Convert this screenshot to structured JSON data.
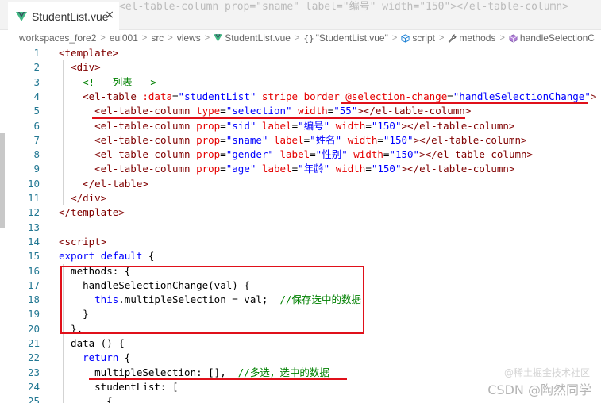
{
  "tab": {
    "title": "StudentList.vue",
    "close": "×"
  },
  "ghost_line": "<el-table-column prop=\"sname\" label=\"编号\" width=\"150\"></el-table-column>",
  "breadcrumb": {
    "items": [
      "workspaces_fore2",
      "eui001",
      "src",
      "views",
      "StudentList.vue",
      "\"StudentList.vue\"",
      "script",
      "methods",
      "handleSelectionC"
    ],
    "separator": ">"
  },
  "colors": {
    "accent_red": "#e0101a",
    "tag": "#800000",
    "attr": "#e50000",
    "string": "#0000ff",
    "comment": "#008000",
    "line_number": "#237893",
    "vue_green": "#41b883"
  },
  "code_lines": [
    {
      "n": "1",
      "tokens": [
        [
          "tag",
          "<template>"
        ]
      ]
    },
    {
      "n": "2",
      "tokens": [
        [
          "txt",
          "  "
        ],
        [
          "tag",
          "<div>"
        ]
      ]
    },
    {
      "n": "3",
      "tokens": [
        [
          "txt",
          "    "
        ],
        [
          "cmt",
          "<!-- 列表 -->"
        ]
      ]
    },
    {
      "n": "4",
      "tokens": [
        [
          "txt",
          "    "
        ],
        [
          "tag",
          "<el-table"
        ],
        [
          "txt",
          " "
        ],
        [
          "attr",
          ":data"
        ],
        [
          "txt",
          "="
        ],
        [
          "str",
          "\"studentList\""
        ],
        [
          "txt",
          " "
        ],
        [
          "attr",
          "stripe"
        ],
        [
          "txt",
          " "
        ],
        [
          "attr",
          "border"
        ],
        [
          "txt",
          " "
        ],
        [
          "attr",
          "@selection-change"
        ],
        [
          "txt",
          "="
        ],
        [
          "str",
          "\"handleSelectionChange\""
        ],
        [
          "tag",
          ">"
        ]
      ]
    },
    {
      "n": "5",
      "tokens": [
        [
          "txt",
          "      "
        ],
        [
          "tag",
          "<el-table-column"
        ],
        [
          "txt",
          " "
        ],
        [
          "attr",
          "type"
        ],
        [
          "txt",
          "="
        ],
        [
          "str",
          "\"selection\""
        ],
        [
          "txt",
          " "
        ],
        [
          "attr",
          "width"
        ],
        [
          "txt",
          "="
        ],
        [
          "str",
          "\"55\""
        ],
        [
          "tag",
          "></el-table-column>"
        ]
      ]
    },
    {
      "n": "6",
      "tokens": [
        [
          "txt",
          "      "
        ],
        [
          "tag",
          "<el-table-column"
        ],
        [
          "txt",
          " "
        ],
        [
          "attr",
          "prop"
        ],
        [
          "txt",
          "="
        ],
        [
          "str",
          "\"sid\""
        ],
        [
          "txt",
          " "
        ],
        [
          "attr",
          "label"
        ],
        [
          "txt",
          "="
        ],
        [
          "str",
          "\"编号\""
        ],
        [
          "txt",
          " "
        ],
        [
          "attr",
          "width"
        ],
        [
          "txt",
          "="
        ],
        [
          "str",
          "\"150\""
        ],
        [
          "tag",
          "></el-table-column>"
        ]
      ]
    },
    {
      "n": "7",
      "tokens": [
        [
          "txt",
          "      "
        ],
        [
          "tag",
          "<el-table-column"
        ],
        [
          "txt",
          " "
        ],
        [
          "attr",
          "prop"
        ],
        [
          "txt",
          "="
        ],
        [
          "str",
          "\"sname\""
        ],
        [
          "txt",
          " "
        ],
        [
          "attr",
          "label"
        ],
        [
          "txt",
          "="
        ],
        [
          "str",
          "\"姓名\""
        ],
        [
          "txt",
          " "
        ],
        [
          "attr",
          "width"
        ],
        [
          "txt",
          "="
        ],
        [
          "str",
          "\"150\""
        ],
        [
          "tag",
          "></el-table-column>"
        ]
      ]
    },
    {
      "n": "8",
      "tokens": [
        [
          "txt",
          "      "
        ],
        [
          "tag",
          "<el-table-column"
        ],
        [
          "txt",
          " "
        ],
        [
          "attr",
          "prop"
        ],
        [
          "txt",
          "="
        ],
        [
          "str",
          "\"gender\""
        ],
        [
          "txt",
          " "
        ],
        [
          "attr",
          "label"
        ],
        [
          "txt",
          "="
        ],
        [
          "str",
          "\"性别\""
        ],
        [
          "txt",
          " "
        ],
        [
          "attr",
          "width"
        ],
        [
          "txt",
          "="
        ],
        [
          "str",
          "\"150\""
        ],
        [
          "tag",
          "></el-table-column>"
        ]
      ]
    },
    {
      "n": "9",
      "tokens": [
        [
          "txt",
          "      "
        ],
        [
          "tag",
          "<el-table-column"
        ],
        [
          "txt",
          " "
        ],
        [
          "attr",
          "prop"
        ],
        [
          "txt",
          "="
        ],
        [
          "str",
          "\"age\""
        ],
        [
          "txt",
          " "
        ],
        [
          "attr",
          "label"
        ],
        [
          "txt",
          "="
        ],
        [
          "str",
          "\"年龄\""
        ],
        [
          "txt",
          " "
        ],
        [
          "attr",
          "width"
        ],
        [
          "txt",
          "="
        ],
        [
          "str",
          "\"150\""
        ],
        [
          "tag",
          "></el-table-column>"
        ]
      ]
    },
    {
      "n": "10",
      "tokens": [
        [
          "txt",
          "    "
        ],
        [
          "tag",
          "</el-table>"
        ]
      ]
    },
    {
      "n": "11",
      "tokens": [
        [
          "txt",
          "  "
        ],
        [
          "tag",
          "</div>"
        ]
      ]
    },
    {
      "n": "12",
      "tokens": [
        [
          "tag",
          "</template>"
        ]
      ]
    },
    {
      "n": "13",
      "tokens": []
    },
    {
      "n": "14",
      "tokens": [
        [
          "tag",
          "<script>"
        ]
      ]
    },
    {
      "n": "15",
      "tokens": [
        [
          "kw",
          "export"
        ],
        [
          "txt",
          " "
        ],
        [
          "kw",
          "default"
        ],
        [
          "txt",
          " {"
        ]
      ]
    },
    {
      "n": "16",
      "tokens": [
        [
          "txt",
          "  methods: {"
        ]
      ]
    },
    {
      "n": "17",
      "tokens": [
        [
          "txt",
          "    handleSelectionChange(val) {"
        ]
      ]
    },
    {
      "n": "18",
      "tokens": [
        [
          "txt",
          "      "
        ],
        [
          "kw",
          "this"
        ],
        [
          "txt",
          ".multipleSelection = val;  "
        ],
        [
          "cmt",
          "//保存选中的数据"
        ]
      ]
    },
    {
      "n": "19",
      "tokens": [
        [
          "txt",
          "    }"
        ]
      ]
    },
    {
      "n": "20",
      "tokens": [
        [
          "txt",
          "  },"
        ]
      ]
    },
    {
      "n": "21",
      "tokens": [
        [
          "txt",
          "  data () {"
        ]
      ]
    },
    {
      "n": "22",
      "tokens": [
        [
          "txt",
          "    "
        ],
        [
          "kw",
          "return"
        ],
        [
          "txt",
          " {"
        ]
      ]
    },
    {
      "n": "23",
      "tokens": [
        [
          "txt",
          "      multipleSelection: [],  "
        ],
        [
          "cmt",
          "//多选，选中的数据"
        ]
      ]
    },
    {
      "n": "24",
      "tokens": [
        [
          "txt",
          "      studentList: ["
        ]
      ]
    },
    {
      "n": "25",
      "tokens": [
        [
          "txt",
          "        {"
        ]
      ]
    }
  ],
  "watermark": "CSDN @陶然同学",
  "watermark2": "@稀土掘金技术社区"
}
